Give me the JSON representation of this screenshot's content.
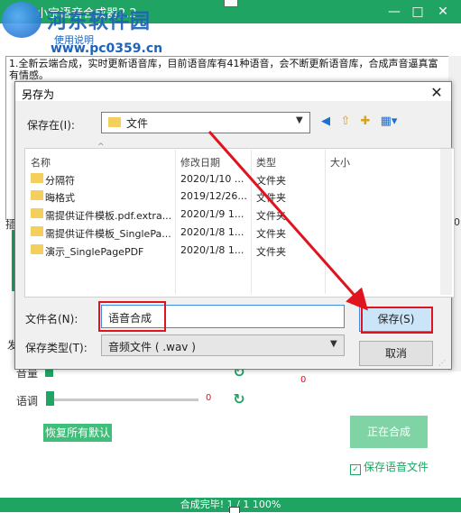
{
  "app": {
    "title": "小宝语音合成器2.2",
    "window_controls": {
      "minimize": "—",
      "maximize": "□",
      "close": "✕"
    },
    "watermark": {
      "text": "河东软件园",
      "url": "www.pc0359.cn",
      "help": "使用说明"
    },
    "text_content": "1.全新云端合成，实时更新语音库，目前语音库有41种语音，会不断更新语音库，合成声音逼真富有情感。",
    "side_labels": {
      "insert": "插",
      "send": "发",
      "volume": "音量",
      "pitch": "语调"
    },
    "pitch_value": "0",
    "volume_value": "0",
    "reset_all_label": "恢复所有默认",
    "synthesize_label": "正在合成",
    "save_voice_label": "保存语音文件",
    "save_voice_checked": true,
    "status_text": "合成完毕! 1 / 1   100%",
    "right_value": "00",
    "accent_color": "#1fa463"
  },
  "dialog": {
    "title": "另存为",
    "save_in_label": "保存在(I):",
    "save_in_value": "文件",
    "columns": [
      "名称",
      "修改日期",
      "类型",
      "大小"
    ],
    "files": [
      {
        "name": "分隔符",
        "date": "2020/1/10 ...",
        "type": "文件夹",
        "size": ""
      },
      {
        "name": "晦格式",
        "date": "2019/12/26...",
        "type": "文件夹",
        "size": ""
      },
      {
        "name": "需提供证件模板.pdf.extra...",
        "date": "2020/1/9 1...",
        "type": "文件夹",
        "size": ""
      },
      {
        "name": "需提供证件模板_SinglePa...",
        "date": "2020/1/8 1...",
        "type": "文件夹",
        "size": ""
      },
      {
        "name": "演示_SinglePagePDF",
        "date": "2020/1/8 1...",
        "type": "文件夹",
        "size": ""
      }
    ],
    "filename_label": "文件名(N):",
    "filename_value": "语音合成",
    "filetype_label": "保存类型(T):",
    "filetype_value": "音频文件 ( .wav )",
    "save_button": "保存(S)",
    "cancel_button": "取消",
    "highlight_color": "#e0141e"
  }
}
